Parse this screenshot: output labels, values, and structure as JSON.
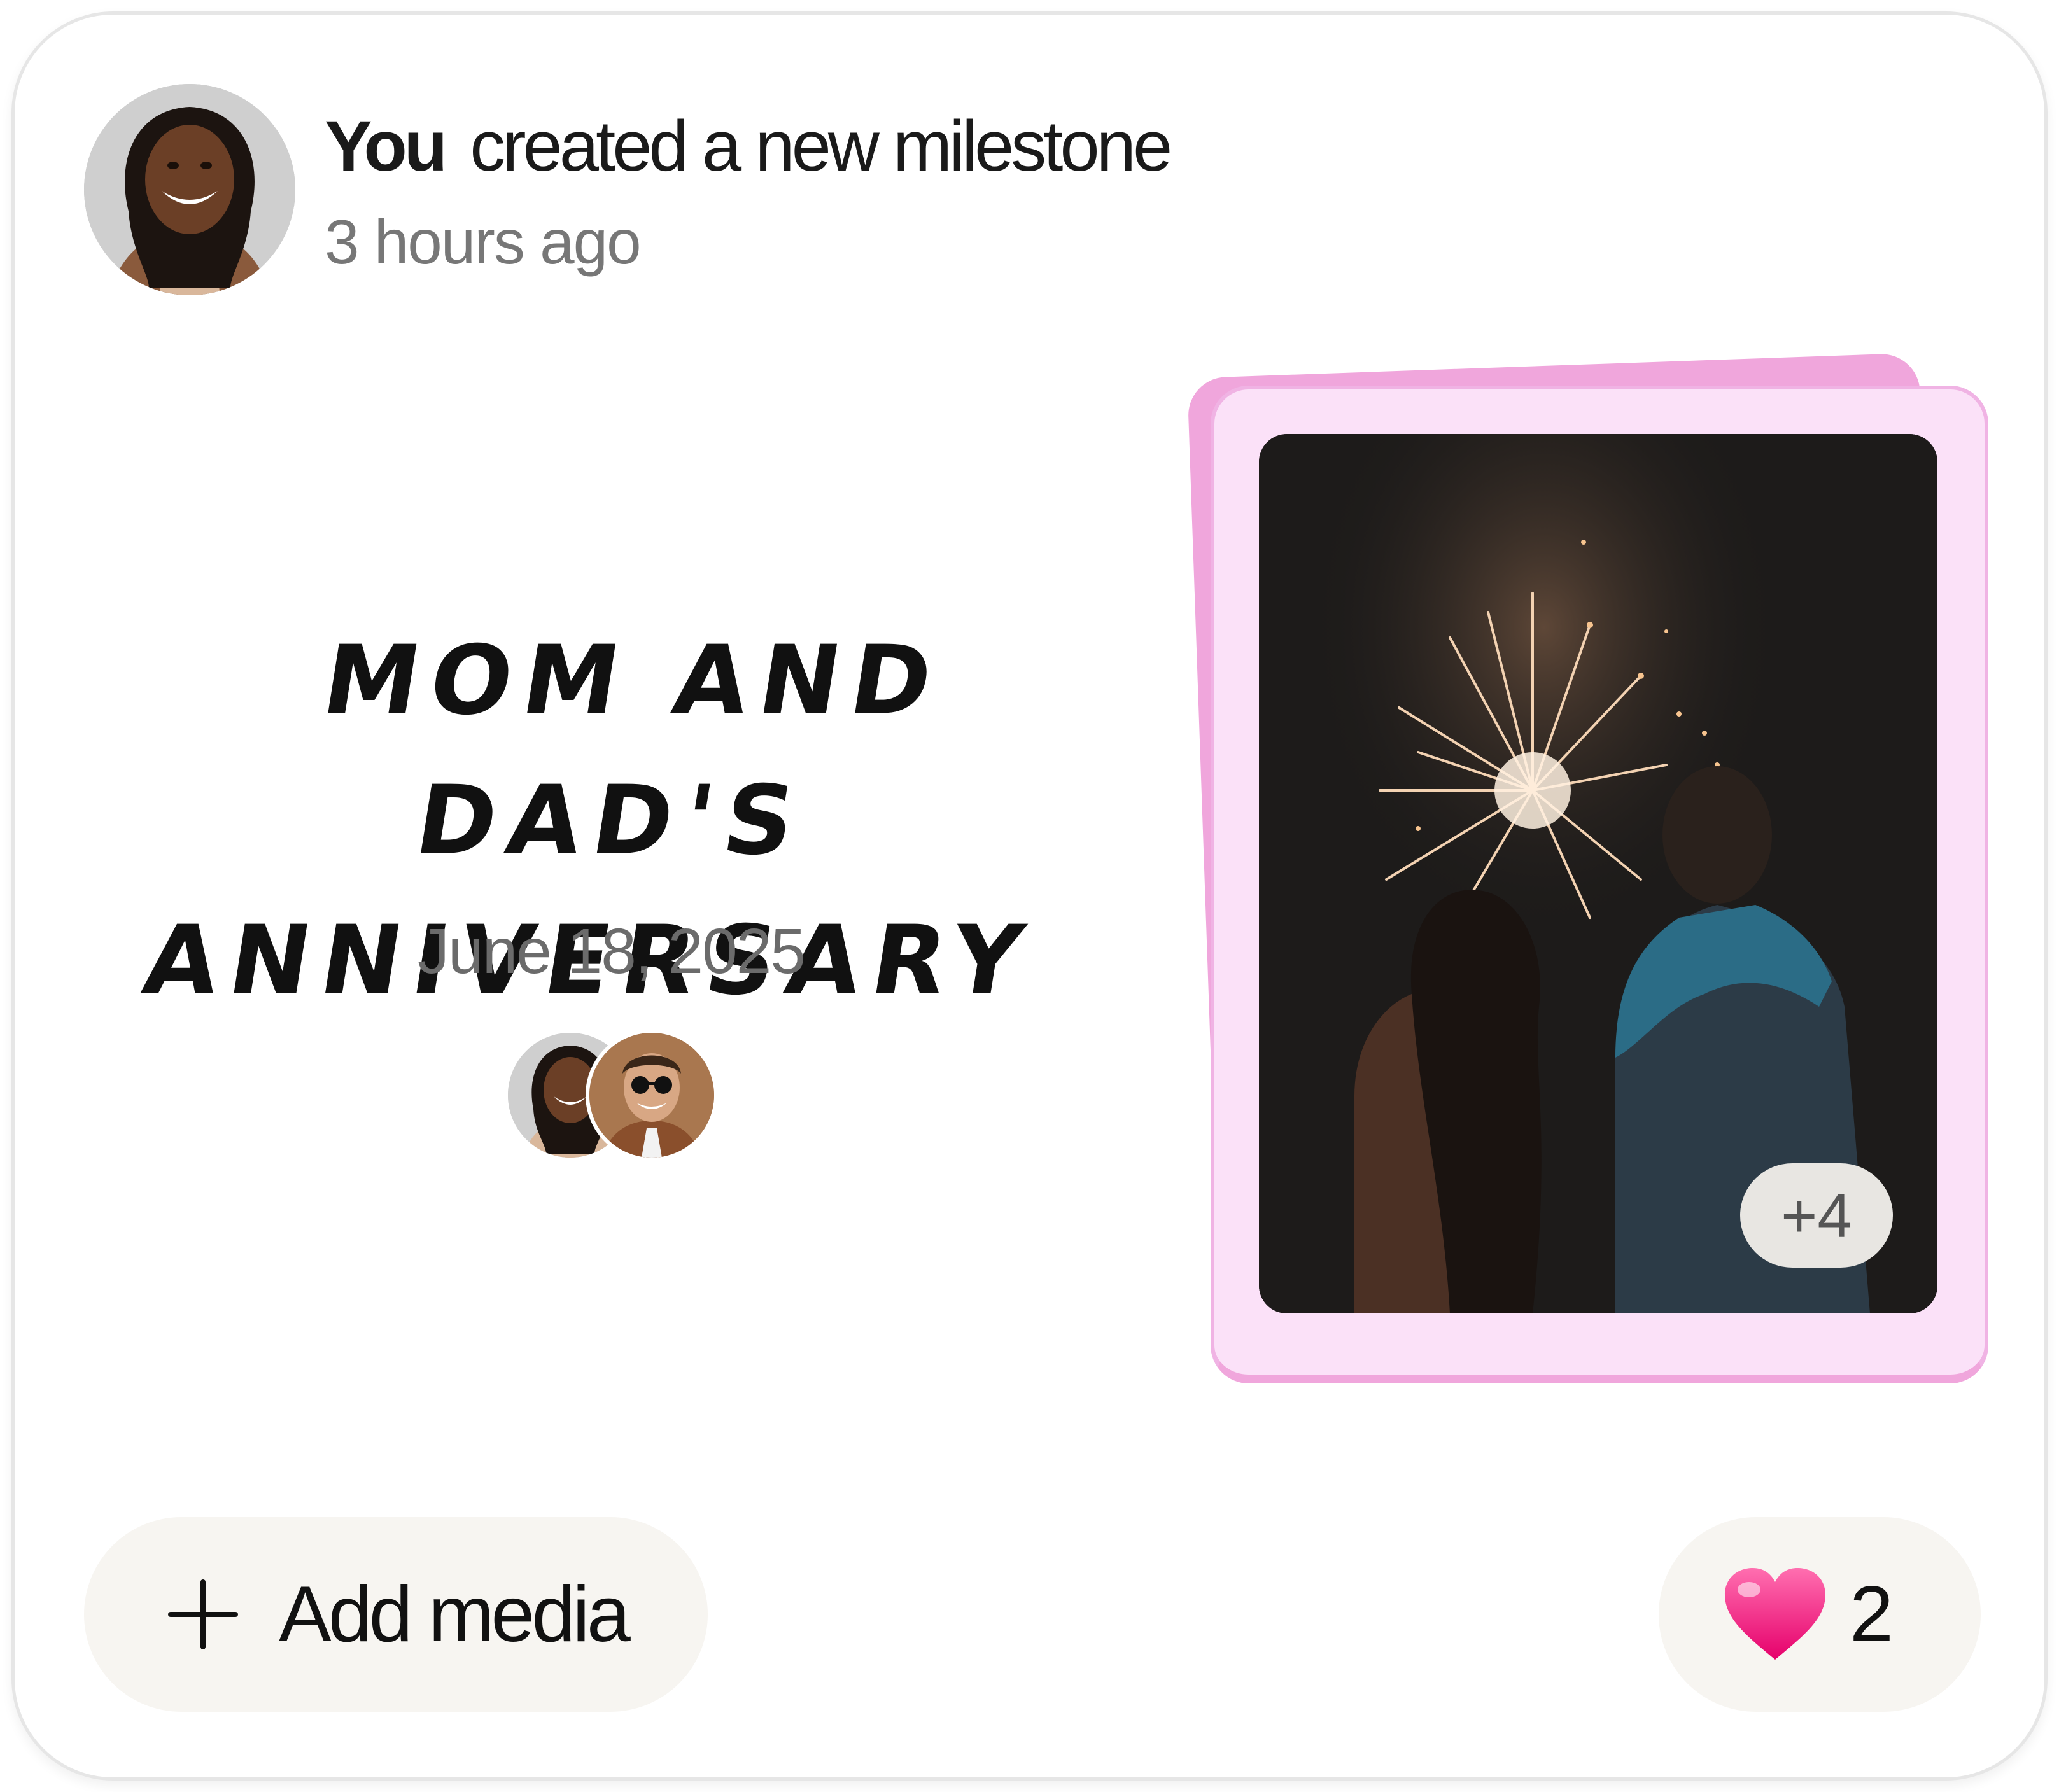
{
  "header": {
    "actor": "You",
    "action": "created a new milestone",
    "timestamp": "3 hours ago",
    "avatar_icon": "user-avatar-woman"
  },
  "milestone": {
    "title_line1": "MOM AND DAD'S",
    "title_line2": "ANNIVERSARY",
    "date": "June 18, 2025",
    "participants": [
      "participant-avatar-woman",
      "participant-avatar-man-sunglasses"
    ]
  },
  "media": {
    "photo_icon": "fireworks-couple-photo",
    "more_count": "+4",
    "frame_color": "#fbe1f8",
    "frame_border_color": "#f0a6dc"
  },
  "actions": {
    "add_media_label": "Add media",
    "add_media_icon": "plus-icon",
    "like_icon": "heart-icon",
    "like_count": "2",
    "like_color": "#ff2d8d"
  }
}
